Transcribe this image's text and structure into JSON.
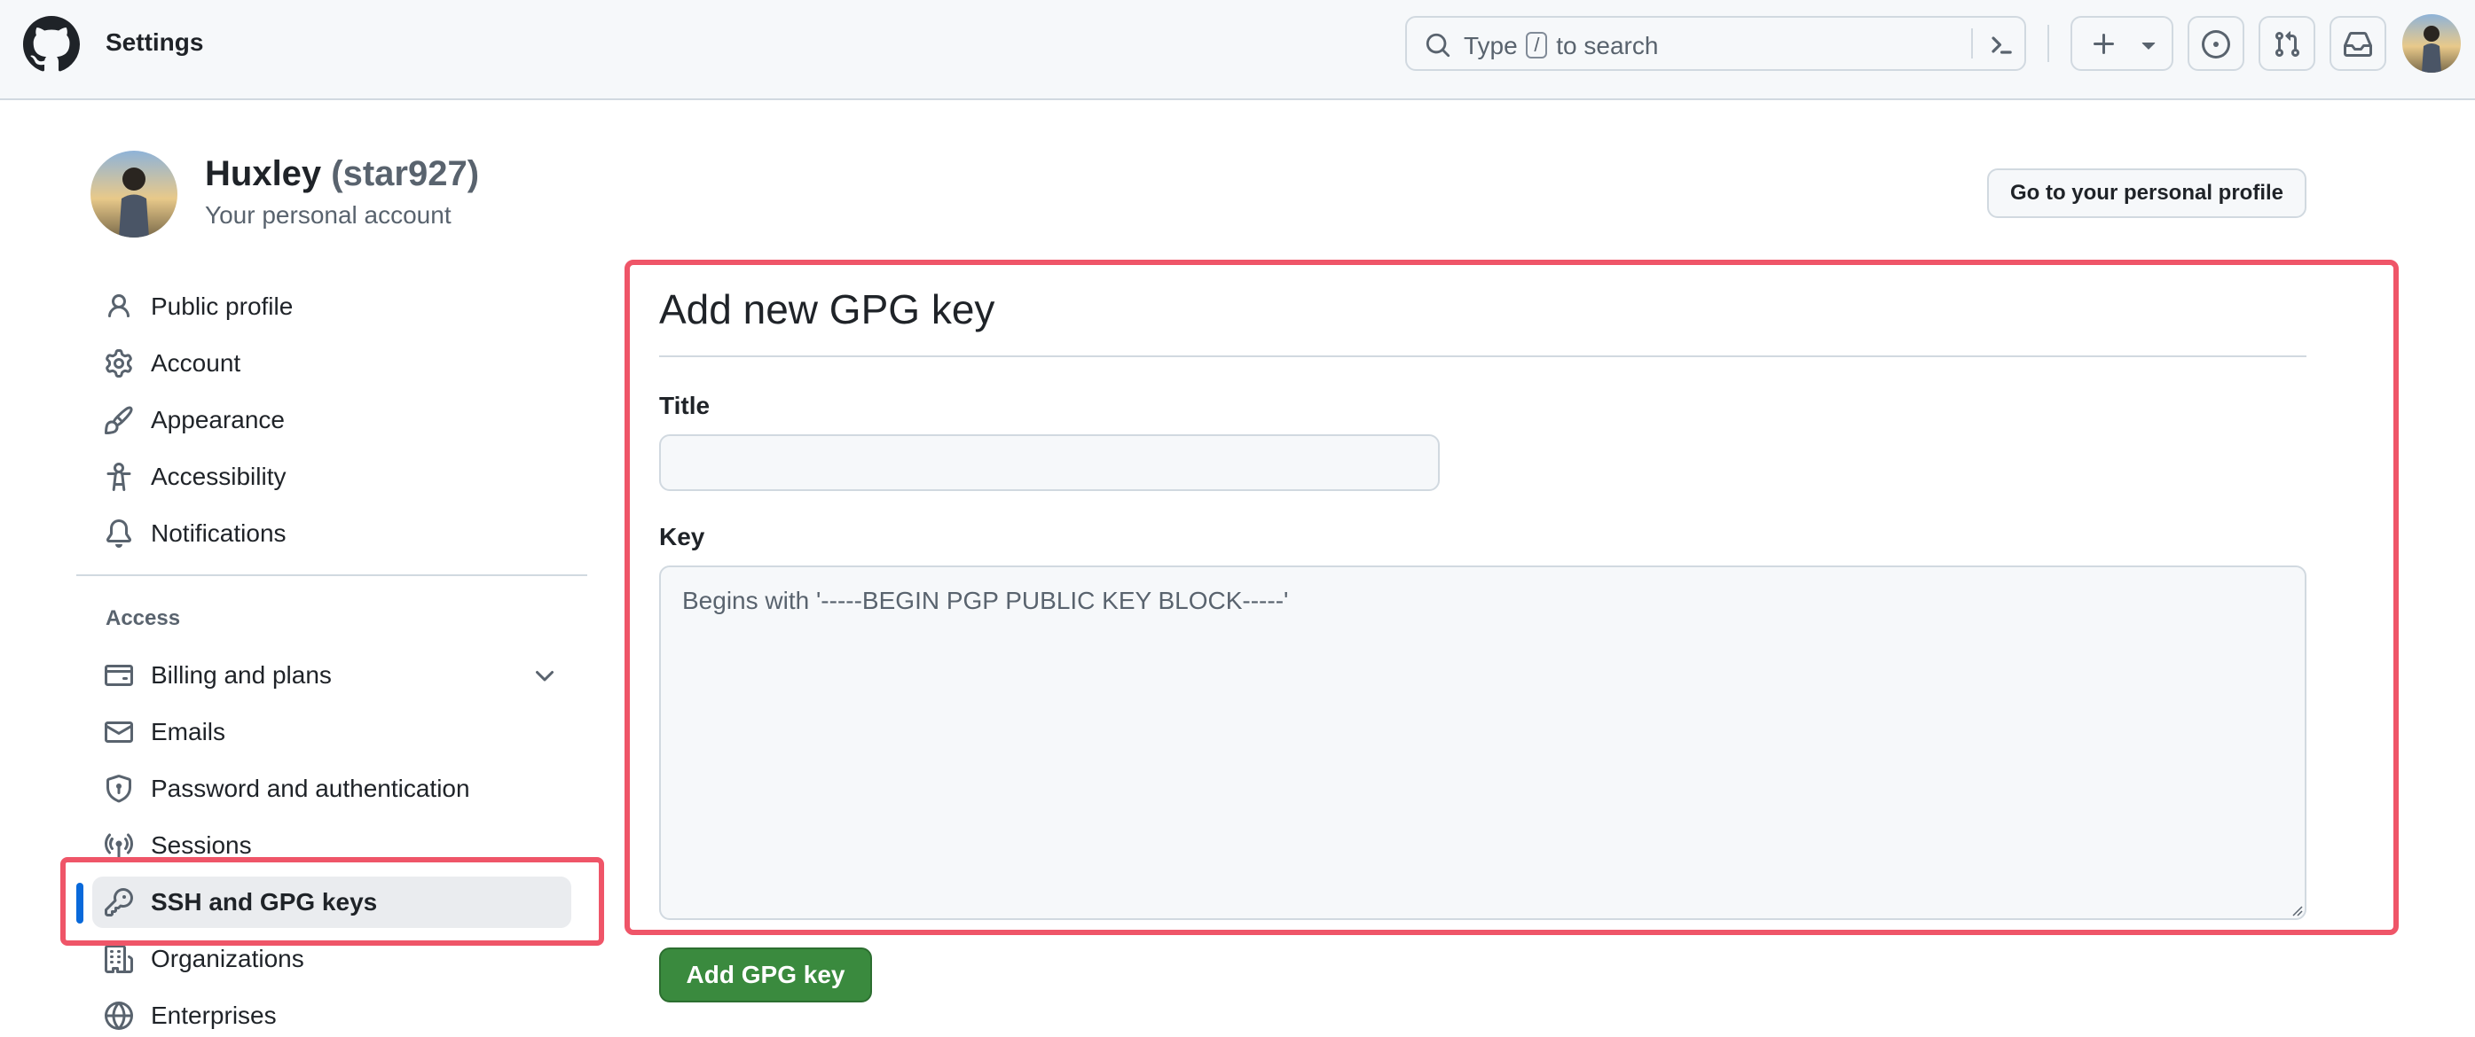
{
  "header": {
    "title": "Settings",
    "search": {
      "prefix": "Type",
      "key": "/",
      "suffix": "to search"
    },
    "icons": [
      "github-logo-icon",
      "search-icon",
      "command-palette-icon",
      "plus-icon",
      "triangle-down-icon",
      "issues-icon",
      "pull-requests-icon",
      "inbox-icon"
    ]
  },
  "profile": {
    "name": "Huxley",
    "handle": "(star927)",
    "subtitle": "Your personal account",
    "profile_button": "Go to your personal profile"
  },
  "sidebar": {
    "items": [
      {
        "label": "Public profile",
        "icon": "person-icon"
      },
      {
        "label": "Account",
        "icon": "gear-icon"
      },
      {
        "label": "Appearance",
        "icon": "paintbrush-icon"
      },
      {
        "label": "Accessibility",
        "icon": "accessibility-icon"
      },
      {
        "label": "Notifications",
        "icon": "bell-icon"
      }
    ],
    "access_label": "Access",
    "access_items": [
      {
        "label": "Billing and plans",
        "icon": "credit-card-icon"
      },
      {
        "label": "Emails",
        "icon": "mail-icon"
      },
      {
        "label": "Password and authentication",
        "icon": "shield-lock-icon"
      },
      {
        "label": "Sessions",
        "icon": "broadcast-icon"
      },
      {
        "label": "SSH and GPG keys",
        "icon": "key-icon",
        "active": true
      },
      {
        "label": "Organizations",
        "icon": "organization-icon"
      },
      {
        "label": "Enterprises",
        "icon": "globe-icon"
      }
    ]
  },
  "main": {
    "title": "Add new GPG key",
    "title_label": "Title",
    "title_value": "",
    "key_label": "Key",
    "key_placeholder": "Begins with '-----BEGIN PGP PUBLIC KEY BLOCK-----'",
    "key_value": "",
    "submit_label": "Add GPG key"
  },
  "colors": {
    "accent": "#0969da",
    "highlight": "#ef5568",
    "primary_button": "#3a8a3e",
    "muted_text": "#59636e",
    "border": "#d1d9e0"
  }
}
